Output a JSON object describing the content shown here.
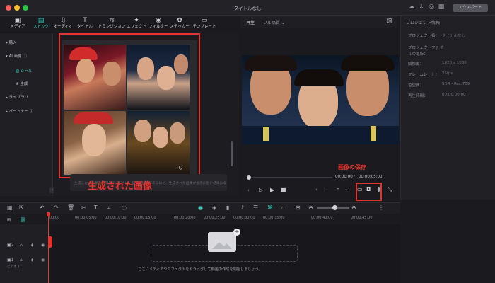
{
  "window": {
    "title": "タイトルなし",
    "export_label": "エクスポート"
  },
  "colors": {
    "accent": "#2fd0c0",
    "annotation_red": "#e4322d"
  },
  "tabs": [
    {
      "label": "メディア",
      "icon": "media-icon"
    },
    {
      "label": "ストック",
      "icon": "stock-icon"
    },
    {
      "label": "オーディオ",
      "icon": "music-icon"
    },
    {
      "label": "タイトル",
      "icon": "title-icon"
    },
    {
      "label": "トランジション",
      "icon": "transition-icon"
    },
    {
      "label": "エフェクト",
      "icon": "effect-icon"
    },
    {
      "label": "フィルター",
      "icon": "filter-icon"
    },
    {
      "label": "ステッカー",
      "icon": "sticker-icon"
    },
    {
      "label": "テンプレート",
      "icon": "template-icon"
    }
  ],
  "sidebar": {
    "items": [
      {
        "label": "▸  購入"
      },
      {
        "label": "▾  AI 画像 ⓘ"
      },
      {
        "label": "シール"
      },
      {
        "label": "生成"
      },
      {
        "label": "▸  ライブラリ"
      },
      {
        "label": "▸  パートナー ⓘ"
      }
    ]
  },
  "media": {
    "prompt_placeholder": "生成したい画像を説明してください。描写が詳細であるほど、生成された画像が指示に近い結果になります。",
    "annotation": "生成された画像"
  },
  "preview": {
    "tab_play": "再生",
    "quality": "フル品質",
    "time_current": "00:00:00",
    "time_total": "00:00:05:00",
    "annotation": "画像の保存"
  },
  "properties": {
    "title": "プロジェクト情報",
    "rows": [
      {
        "label": "プロジェクト名：",
        "value": "タイトルなし"
      },
      {
        "label": "プロジェクトファイルの場所：",
        "value": "/"
      },
      {
        "label": "解像度：",
        "value": "1920 x 1080"
      },
      {
        "label": "フレームレート：",
        "value": "25fps"
      },
      {
        "label": "色空間：",
        "value": "SDR - Rec.709"
      },
      {
        "label": "再生時間：",
        "value": "00:00:00:00"
      }
    ]
  },
  "timeline": {
    "ticks": [
      "00:00",
      "00:00:05:00",
      "00:00:10:00",
      "00:00:15:00",
      "00:00:20:00",
      "00:00:25:00",
      "00:00:30:00",
      "00:00:35:00",
      "00:00:40:00",
      "00:00:45:00"
    ],
    "track_labels": [
      "2",
      "1"
    ],
    "track_name": "ビデオ 1",
    "drop_hint": "ここにメディアやエフェクトをドラッグして動画の作成を開始しましょう。"
  }
}
